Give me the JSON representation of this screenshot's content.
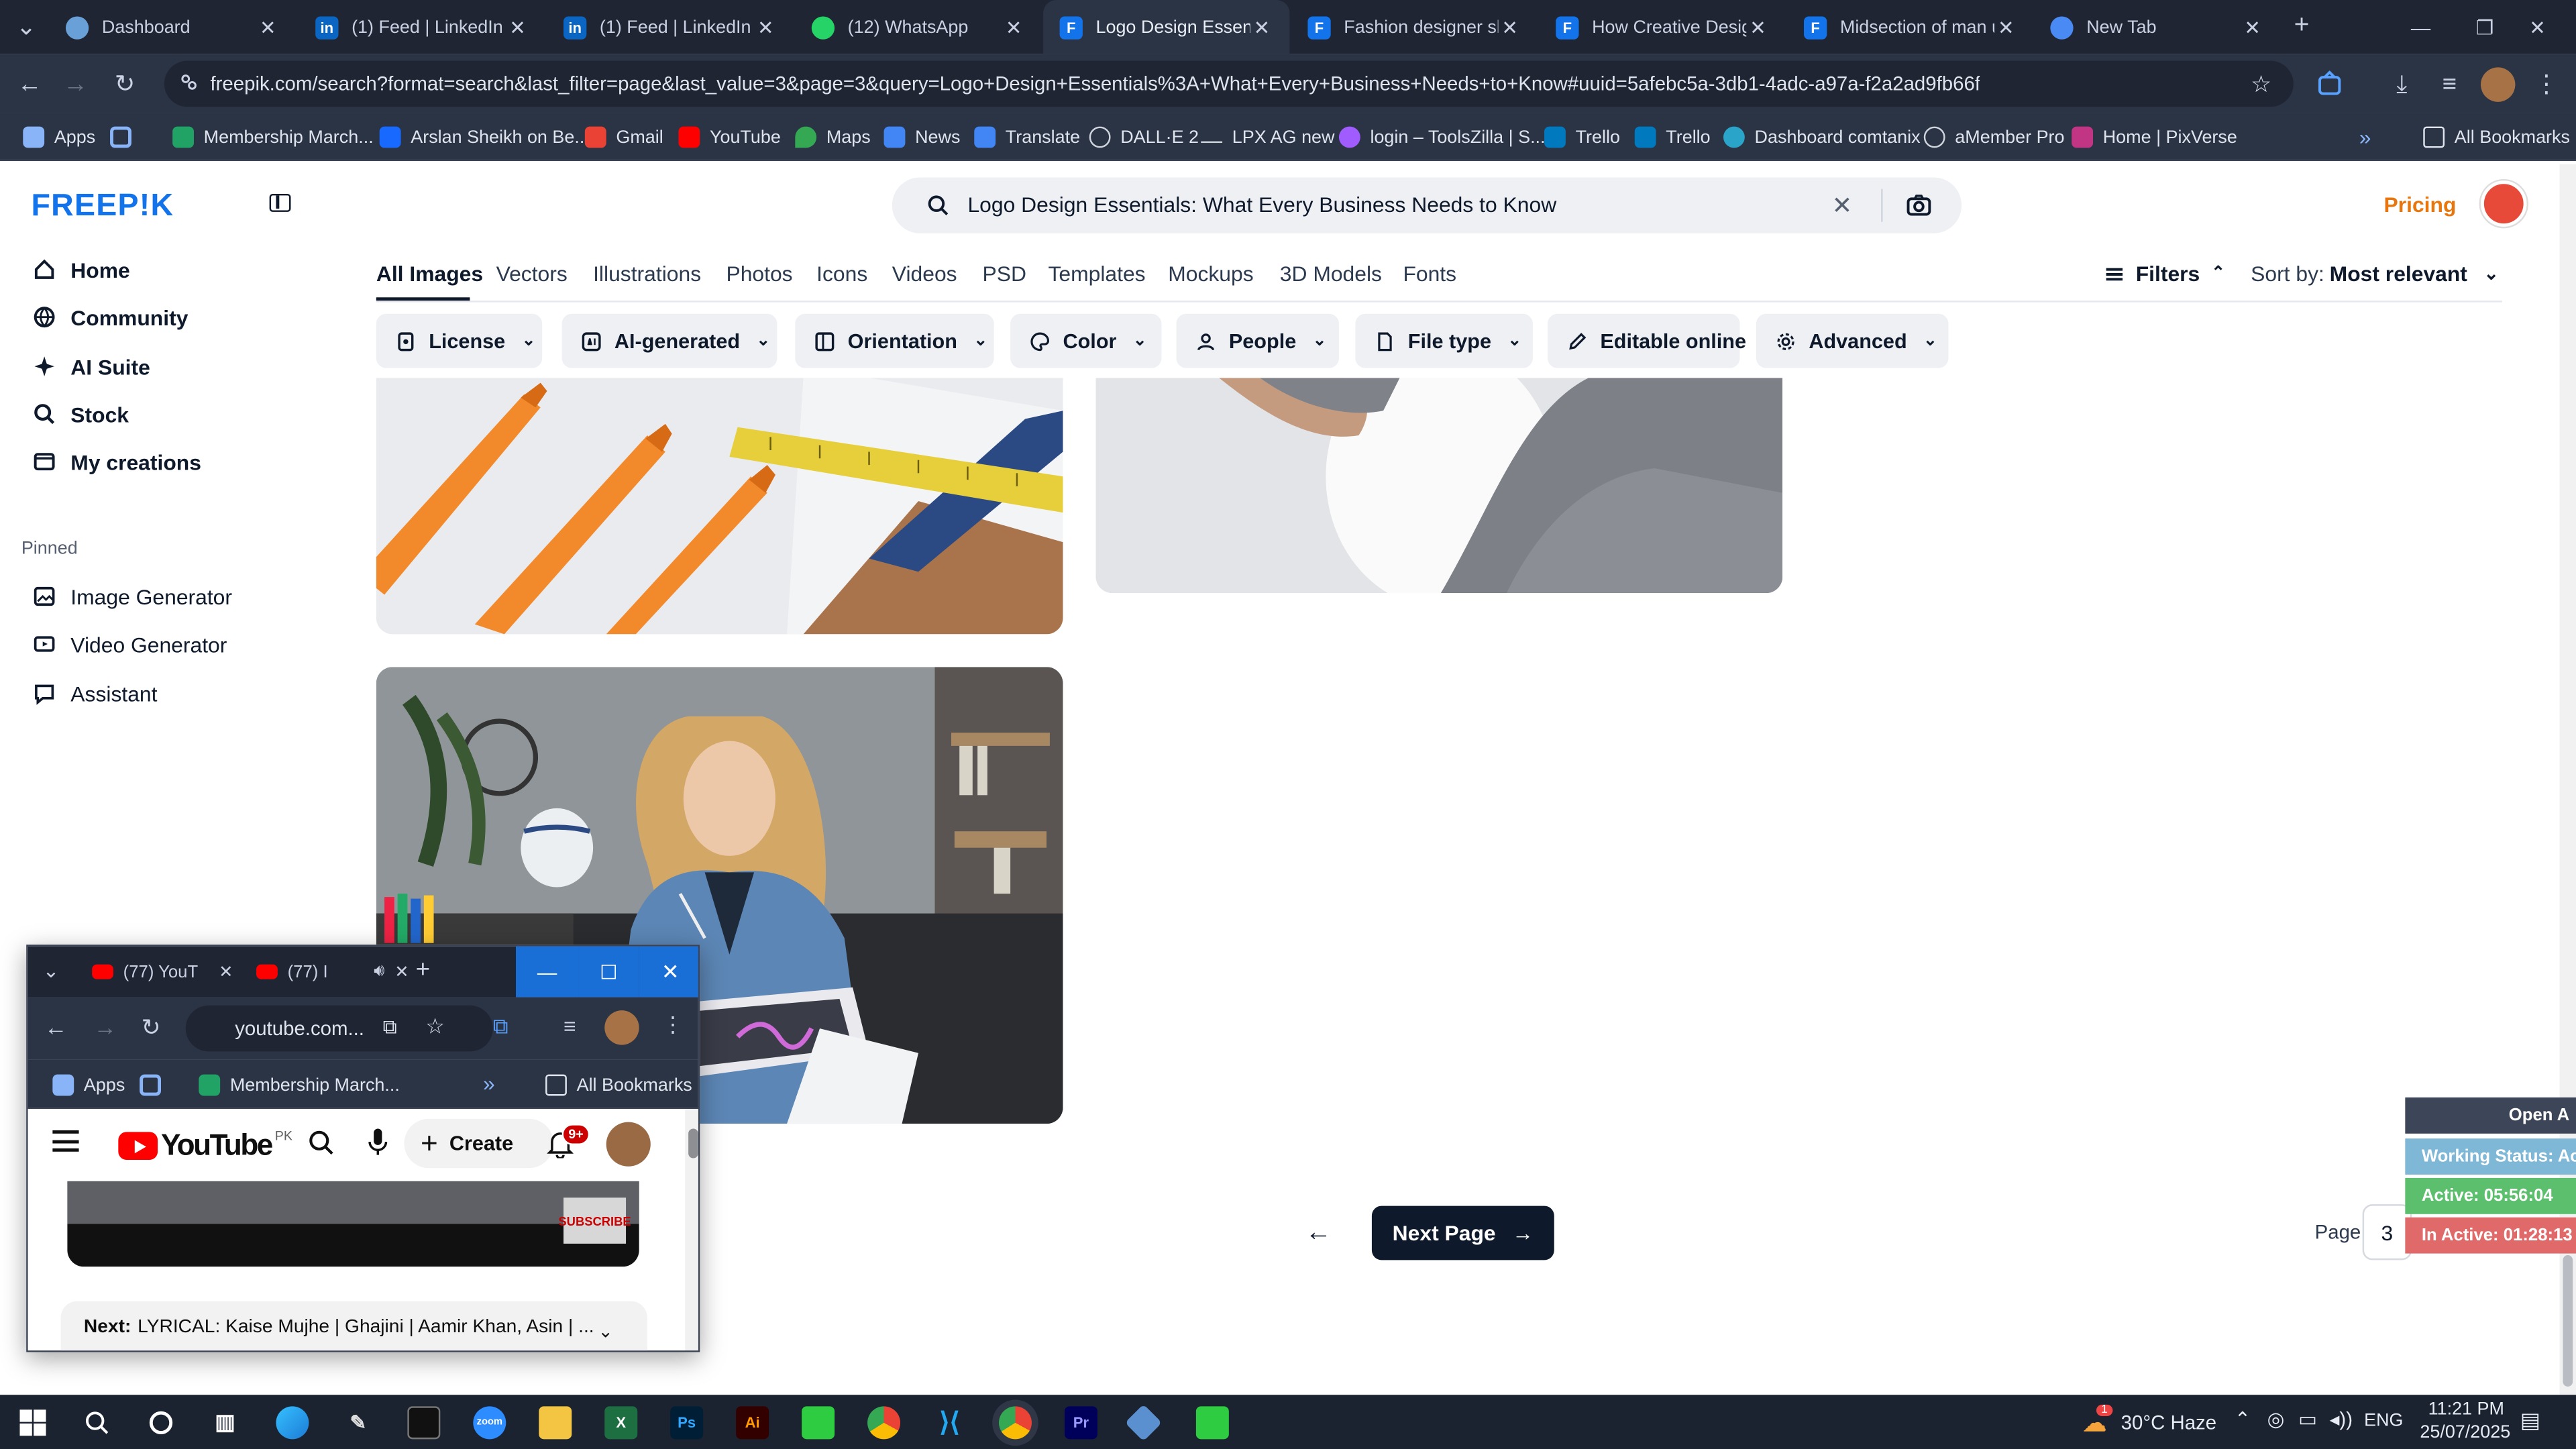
{
  "browser": {
    "tabs": [
      {
        "title": "Dashboard",
        "color": "#6aa0d8"
      },
      {
        "title": "(1) Feed | LinkedIn",
        "color": "#0a66c2"
      },
      {
        "title": "(1) Feed | LinkedIn",
        "color": "#0a66c2"
      },
      {
        "title": "(12) WhatsApp",
        "color": "#25d366"
      },
      {
        "title": "Logo Design Essenti",
        "color": "#1273eb"
      },
      {
        "title": "Fashion designer ske",
        "color": "#1273eb"
      },
      {
        "title": "How Creative Design",
        "color": "#1273eb"
      },
      {
        "title": "Midsection of man u",
        "color": "#1273eb"
      },
      {
        "title": "New Tab",
        "color": "#4a8af4"
      }
    ],
    "active_tab_index": 4,
    "url": "freepik.com/search?format=search&last_filter=page&last_value=3&page=3&query=Logo+Design+Essentials%3A+What+Every+Business+Needs+to+Know#uuid=5afebc5a-3db1-4adc-a97a-f2a2ad9fb66f",
    "bookmarks": [
      {
        "label": "Apps",
        "color": "#8ab4f8"
      },
      {
        "label": "",
        "color": "#8ab4f8"
      },
      {
        "label": "Membership March...",
        "color": "#21a366"
      },
      {
        "label": "Arslan Sheikh on Be...",
        "color": "#1769ff"
      },
      {
        "label": "Gmail",
        "color": "#ea4335"
      },
      {
        "label": "YouTube",
        "color": "#ff0000"
      },
      {
        "label": "Maps",
        "color": "#34a853"
      },
      {
        "label": "News",
        "color": "#4285f4"
      },
      {
        "label": "Translate",
        "color": "#4285f4"
      },
      {
        "label": "DALL·E 2",
        "color": "#cfd4dd"
      },
      {
        "label": "LPX AG new",
        "color": "#cfd4dd"
      },
      {
        "label": "login – ToolsZilla | S...",
        "color": "#a05cff"
      },
      {
        "label": "Trello",
        "color": "#0079bf"
      },
      {
        "label": "Trello",
        "color": "#0079bf"
      },
      {
        "label": "Dashboard comtanix",
        "color": "#2aa5c9"
      },
      {
        "label": "aMember Pro",
        "color": "#cfd4dd"
      },
      {
        "label": "Home | PixVerse",
        "color": "#c13584"
      }
    ],
    "all_bookmarks": "All Bookmarks"
  },
  "freepik": {
    "logo": "FREEP!K",
    "nav": [
      {
        "label": "Home",
        "icon": "home-icon"
      },
      {
        "label": "Community",
        "icon": "globe-icon"
      },
      {
        "label": "AI Suite",
        "icon": "sparkle-icon"
      },
      {
        "label": "Stock",
        "icon": "search-icon"
      },
      {
        "label": "My creations",
        "icon": "folder-icon"
      }
    ],
    "pinned_label": "Pinned",
    "pinned": [
      {
        "label": "Image Generator",
        "icon": "image-icon"
      },
      {
        "label": "Video Generator",
        "icon": "video-icon"
      },
      {
        "label": "Assistant",
        "icon": "chat-icon"
      }
    ],
    "search_query": "Logo Design Essentials: What Every Business Needs to Know",
    "pricing": "Pricing",
    "categories": [
      "All Images",
      "Vectors",
      "Illustrations",
      "Photos",
      "Icons",
      "Videos",
      "PSD",
      "Templates",
      "Mockups",
      "3D Models",
      "Fonts"
    ],
    "active_category": "All Images",
    "filters_label": "Filters",
    "sort_label": "Sort by:",
    "sort_value": "Most relevant",
    "chips": [
      {
        "label": "License",
        "icon": "license-icon",
        "dropdown": true
      },
      {
        "label": "AI-generated",
        "icon": "ai-icon",
        "dropdown": true
      },
      {
        "label": "Orientation",
        "icon": "orientation-icon",
        "dropdown": true
      },
      {
        "label": "Color",
        "icon": "palette-icon",
        "dropdown": true
      },
      {
        "label": "People",
        "icon": "people-icon",
        "dropdown": true
      },
      {
        "label": "File type",
        "icon": "file-icon",
        "dropdown": true
      },
      {
        "label": "Editable online",
        "icon": "pencil-icon",
        "dropdown": false
      },
      {
        "label": "Advanced",
        "icon": "gear-icon",
        "dropdown": true
      }
    ],
    "pagination": {
      "next_label": "Next Page",
      "page_label": "Page",
      "page_value": "3"
    }
  },
  "tracker": {
    "open": "Open A",
    "status": "Working Status: Acti",
    "active": "Active: 05:56:04",
    "inactive": "In Active: 01:28:13"
  },
  "youtube_window": {
    "tabs": [
      "(77) YouT",
      "(77) I"
    ],
    "url": "youtube.com...",
    "bookmarks": [
      "Apps",
      "Membership March..."
    ],
    "all_bookmarks": "All Bookmarks",
    "logo_text": "YouTube",
    "region": "PK",
    "create_label": "Create",
    "notif_count": "9+",
    "subscribe_label": "SUBSCRIBE",
    "next_prefix": "Next:",
    "next_title": "LYRICAL: Kaise Mujhe | Ghajini | Aamir Khan, Asin | ..."
  },
  "taskbar": {
    "weather": "30°C Haze",
    "weather_badge": "1",
    "lang": "ENG",
    "time": "11:21 PM",
    "date": "25/07/2025"
  }
}
